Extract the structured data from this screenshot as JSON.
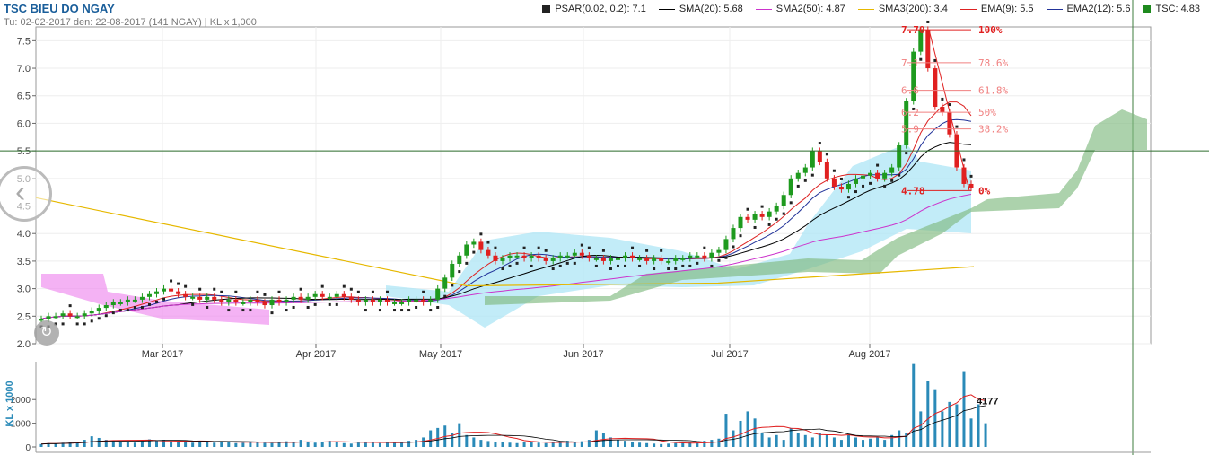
{
  "header": {
    "title": "TSC BIEU DO NGAY",
    "subtitle": "Tu: 02-02-2017 den: 22-08-2017 (141 NGAY) | KL x 1,000"
  },
  "legend": [
    {
      "label": "PSAR(0.02, 0.2): 7.1",
      "color": "#222222",
      "kind": "box"
    },
    {
      "label": "SMA(20): 5.68",
      "color": "#000000",
      "kind": "line"
    },
    {
      "label": "SMA2(50): 4.87",
      "color": "#cc33cc",
      "kind": "line"
    },
    {
      "label": "SMA3(200): 3.4",
      "color": "#e6b800",
      "kind": "line"
    },
    {
      "label": "EMA(9): 5.5",
      "color": "#dd2222",
      "kind": "line"
    },
    {
      "label": "EMA2(12): 5.6",
      "color": "#223399",
      "kind": "line"
    },
    {
      "label": "TSC: 4.83",
      "color": "#1e8a1e",
      "kind": "box"
    }
  ],
  "nav": {
    "prev_icon": "chevron-left-icon",
    "reset_icon": "reset-icon"
  },
  "chart_data": {
    "type": "candlestick",
    "price_axis": {
      "ylim": [
        2.0,
        7.75
      ],
      "ticks": [
        "2.0",
        "2.5",
        "3.0",
        "3.5",
        "4.0",
        "4.5",
        "5.0",
        "5.5",
        "6.0",
        "6.5",
        "7.0",
        "7.5"
      ]
    },
    "x_axis": {
      "months": [
        "Mar 2017",
        "Apr 2017",
        "May 2017",
        "Jun 2017",
        "Jul 2017",
        "Aug 2017"
      ]
    },
    "current_price_line": 5.5,
    "fibonacci": {
      "levels": [
        {
          "price": 7.7,
          "pct": "100%",
          "label": "7.70"
        },
        {
          "price": 7.1,
          "pct": "78.6%",
          "label": "7.1"
        },
        {
          "price": 6.6,
          "pct": "61.8%",
          "label": "6.6"
        },
        {
          "price": 6.2,
          "pct": "50%",
          "label": "6.2"
        },
        {
          "price": 5.9,
          "pct": "38.2%",
          "label": "5.9"
        },
        {
          "price": 4.78,
          "pct": "0%",
          "label": "4.78"
        }
      ]
    },
    "closes": [
      2.45,
      2.5,
      2.5,
      2.55,
      2.5,
      2.5,
      2.55,
      2.6,
      2.65,
      2.7,
      2.75,
      2.75,
      2.8,
      2.8,
      2.85,
      2.9,
      2.95,
      3.0,
      2.95,
      2.9,
      2.85,
      2.85,
      2.8,
      2.85,
      2.8,
      2.75,
      2.8,
      2.75,
      2.75,
      2.8,
      2.75,
      2.7,
      2.8,
      2.75,
      2.8,
      2.85,
      2.8,
      2.85,
      2.9,
      2.85,
      2.85,
      2.9,
      2.85,
      2.8,
      2.75,
      2.8,
      2.75,
      2.8,
      2.75,
      2.75,
      2.75,
      2.8,
      2.8,
      2.75,
      2.8,
      3.0,
      3.2,
      3.45,
      3.6,
      3.8,
      3.85,
      3.7,
      3.6,
      3.5,
      3.55,
      3.6,
      3.6,
      3.55,
      3.6,
      3.55,
      3.5,
      3.55,
      3.6,
      3.6,
      3.65,
      3.6,
      3.55,
      3.55,
      3.5,
      3.55,
      3.55,
      3.6,
      3.55,
      3.55,
      3.5,
      3.55,
      3.5,
      3.5,
      3.55,
      3.55,
      3.6,
      3.6,
      3.55,
      3.65,
      3.7,
      3.9,
      4.1,
      4.3,
      4.25,
      4.35,
      4.3,
      4.4,
      4.5,
      4.7,
      5.0,
      5.1,
      5.2,
      5.5,
      5.3,
      5.0,
      4.85,
      4.8,
      4.9,
      5.0,
      5.05,
      5.1,
      5.0,
      5.1,
      5.2,
      5.6,
      6.4,
      7.3,
      7.7,
      7.0,
      6.3,
      6.2,
      5.8,
      5.2,
      4.9,
      4.83
    ],
    "sma3_200": [
      4.65,
      3.05,
      3.1,
      3.4
    ],
    "volume_axis": {
      "label": "KL x 1000",
      "ticks": [
        "0",
        "1000",
        "2000"
      ],
      "last_value": "4177"
    },
    "volume": [
      120,
      160,
      140,
      180,
      200,
      220,
      300,
      450,
      380,
      300,
      250,
      200,
      240,
      180,
      260,
      320,
      280,
      300,
      240,
      200,
      220,
      180,
      260,
      200,
      180,
      240,
      200,
      160,
      180,
      220,
      200,
      180,
      160,
      200,
      240,
      200,
      300,
      220,
      180,
      200,
      260,
      200,
      160,
      140,
      180,
      200,
      220,
      160,
      180,
      200,
      220,
      260,
      300,
      400,
      700,
      800,
      900,
      600,
      1000,
      500,
      400,
      300,
      250,
      220,
      200,
      180,
      160,
      200,
      220,
      180,
      160,
      200,
      220,
      260,
      200,
      240,
      300,
      700,
      600,
      400,
      300,
      260,
      200,
      180,
      160,
      140,
      120,
      140,
      160,
      180,
      200,
      220,
      260,
      300,
      350,
      1400,
      700,
      1100,
      1500,
      1200,
      600,
      400,
      500,
      300,
      800,
      600,
      500,
      400,
      600,
      500,
      400,
      300,
      500,
      400,
      300,
      350,
      400,
      300,
      500,
      700,
      600,
      3500,
      1500,
      2800,
      2400,
      1500,
      1900,
      1800,
      3200,
      1200,
      1800,
      1000
    ]
  }
}
